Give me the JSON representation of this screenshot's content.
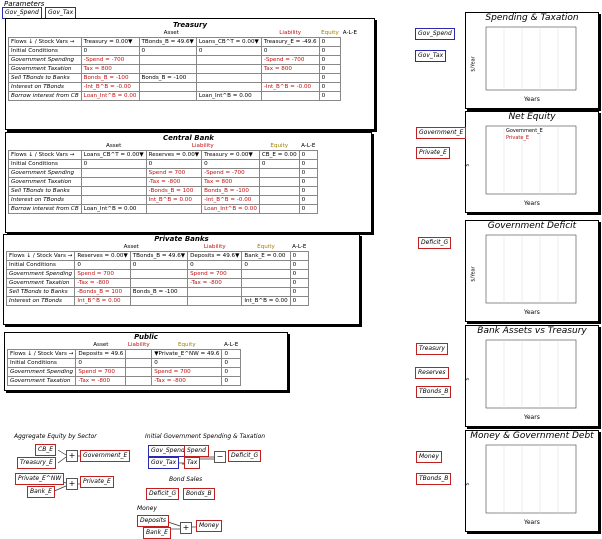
{
  "parameters": {
    "title": "Parameters",
    "gov_spend": "Gov_Spend",
    "gov_tax": "Gov_Tax"
  },
  "treasury": {
    "title": "Treasury",
    "headers": [
      "Asset",
      "Liability",
      "Equity",
      "A-L-E"
    ],
    "rows": [
      [
        "Flows ↓ / Stock Vars →",
        "Treasury = 0.00▼",
        "TBonds_B = 49.6▼",
        "Loans_CB^T = 0.00▼",
        "Treasury_E = -49.6",
        "0"
      ],
      [
        "Initial Conditions",
        "0",
        "0",
        "0",
        "0",
        "0"
      ],
      [
        "Government Spending",
        "-Spend = -700",
        "",
        "",
        "-Spend = -700",
        "0"
      ],
      [
        "Government Taxation",
        "Tax = 800",
        "",
        "",
        "Tax = 800",
        "0"
      ],
      [
        "Sell TBonds to Banks",
        "Bonds_B = -100",
        "Bonds_B = -100",
        "",
        "",
        "0"
      ],
      [
        "Interest on TBonds",
        "-Int_B^B = -0.00",
        "",
        "",
        "-Int_B^B = -0.00",
        "0"
      ],
      [
        "Borrow interest from CB",
        "Loan_Int^B = 0.00",
        "",
        "Loan_Int^B = 0.00",
        "",
        "0"
      ]
    ]
  },
  "central_bank": {
    "title": "Central Bank",
    "headers": [
      "Asset",
      "Liability",
      "Equity",
      "A-L-E"
    ],
    "rows": [
      [
        "Flows ↓ / Stock Vars →",
        "Loans_CB^T = 0.00▼",
        "Reserves = 0.00▼",
        "Treasury = 0.00▼",
        "CB_E = 0.00",
        "0"
      ],
      [
        "Initial Conditions",
        "0",
        "0",
        "0",
        "0",
        "0"
      ],
      [
        "Government Spending",
        "",
        "Spend = 700",
        "-Spend = -700",
        "",
        "0"
      ],
      [
        "Government Taxation",
        "",
        "-Tax = -800",
        "Tax = 800",
        "",
        "0"
      ],
      [
        "Sell TBonds to Banks",
        "",
        "-Bonds_B = 100",
        "Bonds_B = -100",
        "",
        "0"
      ],
      [
        "Interest on TBonds",
        "",
        "Int_B^B = 0.00",
        "-Int_B^B = -0.00",
        "",
        "0"
      ],
      [
        "Borrow interest from CB",
        "Loan_Int^B = 0.00",
        "",
        "Loan_Int^B = 0.00",
        "",
        "0"
      ]
    ]
  },
  "private_banks": {
    "title": "Private Banks",
    "headers": [
      "Asset",
      "Liability",
      "Equity",
      "A-L-E"
    ],
    "rows": [
      [
        "Flows ↓ / Stock Vars →",
        "Reserves = 0.00▼",
        "TBonds_B = 49.6▼",
        "Deposits = 49.6▼",
        "Bank_E = 0.00",
        "0"
      ],
      [
        "Initial Conditions",
        "0",
        "0",
        "0",
        "0",
        "0"
      ],
      [
        "Government Spending",
        "Spend = 700",
        "",
        "Spend = 700",
        "",
        "0"
      ],
      [
        "Government Taxation",
        "-Tax = -800",
        "",
        "-Tax = -800",
        "",
        "0"
      ],
      [
        "Sell TBonds to Banks",
        "-Bonds_B = 100",
        "Bonds_B = -100",
        "",
        "",
        "0"
      ],
      [
        "Interest on TBonds",
        "Int_B^B = 0.00",
        "",
        "",
        "Int_B^B = 0.00",
        "0"
      ]
    ]
  },
  "public": {
    "title": "Public",
    "headers": [
      "Asset",
      "Liability",
      "Equity",
      "A-L-E"
    ],
    "rows": [
      [
        "Flows ↓ / Stock Vars →",
        "Deposits = 49.6",
        "",
        "▼Private_E^NW = 49.6",
        "0"
      ],
      [
        "Initial Conditions",
        "0",
        "",
        "0",
        "0"
      ],
      [
        "Government Spending",
        "Spend = 700",
        "",
        "Spend = 700",
        "0"
      ],
      [
        "Government Taxation",
        "-Tax = -800",
        "",
        "-Tax = -800",
        "0"
      ]
    ]
  },
  "diagram": {
    "agg_equity_title": "Aggregate Equity by Sector",
    "initial_title": "Initial Government Spending & Taxation",
    "bond_sales_title": "Bond Sales",
    "money_title": "Money",
    "cb_e": "CB_E",
    "treasury_e": "Treasury_E",
    "government_e": "Government_E",
    "private_e_nw": "Private_E^NW",
    "bank_e": "Bank_E",
    "private_e": "Private_E",
    "gov_spend": "Gov_Spend",
    "gov_tax": "Gov_Tax",
    "spend": "Spend",
    "tax": "Tax",
    "deficit_g": "Deficit_G",
    "deficit_g2": "Deficit_G",
    "bonds_b": "Bonds_B",
    "deposits": "Deposits",
    "bank_e2": "Bank_E",
    "money": "Money"
  },
  "plots": [
    {
      "title": "Spending & Taxation",
      "inputs": [
        "Gov_Spend",
        "Gov_Tax"
      ],
      "ylabel": "$/Year",
      "xlabel": "Years"
    },
    {
      "title": "Net Equity",
      "inputs": [
        "Government_E",
        "Private_E"
      ],
      "ylabel": "$",
      "xlabel": "Years",
      "legend": [
        "Government_E",
        "Private_E"
      ]
    },
    {
      "title": "Government Deficit",
      "inputs": [
        "Deficit_G"
      ],
      "ylabel": "$/Year",
      "xlabel": "Years"
    },
    {
      "title": "Bank Assets vs Treasury",
      "inputs": [
        "Treasury",
        "Reserves",
        "TBonds_B"
      ],
      "ylabel": "$",
      "xlabel": "Years"
    },
    {
      "title": "Money & Government Debt",
      "inputs": [
        "Money",
        "TBonds_B"
      ],
      "ylabel": "$",
      "xlabel": "Years"
    }
  ],
  "colors": {
    "param_border": "#2a2ab0",
    "var_border": "#c02020",
    "liability": "#c01010",
    "equity": "#a08000",
    "green": "#20a020",
    "red": "#c01010"
  }
}
